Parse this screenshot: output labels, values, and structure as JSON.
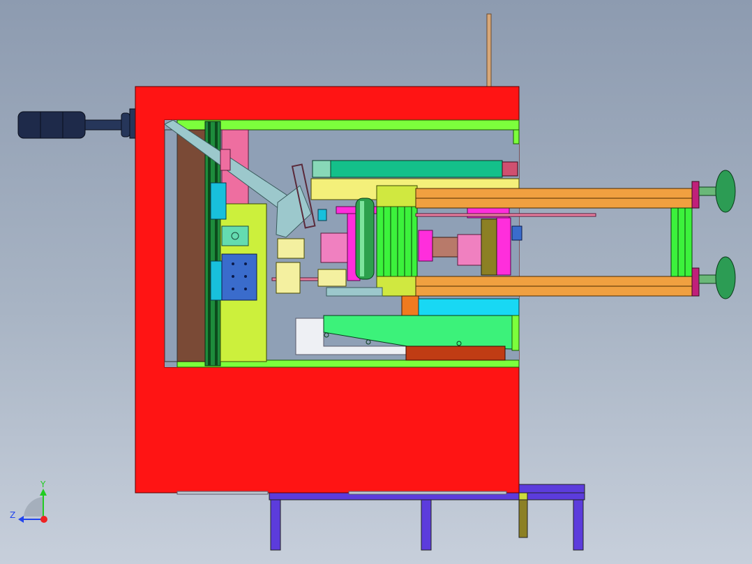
{
  "viewport": {
    "background_top": "#8d9bb0",
    "background_bottom": "#c7cfdb"
  },
  "colors": {
    "frame_red": "#ff1414",
    "frame_green": "#7cff3c",
    "yellow_green": "#ccf03c",
    "brown": "#7a4a36",
    "pink": "#ee6ea0",
    "magenta": "#ff2edc",
    "orange": "#f0a040",
    "teal": "#14c08a",
    "cyan": "#18d8f4",
    "blue": "#3a6ccc",
    "navy": "#1e2a4a",
    "purple": "#5c3cdc",
    "olive": "#8c8024",
    "rust": "#c03c14",
    "green_bar": "#3cf23c",
    "knob_green": "#2c9c54"
  },
  "triad": {
    "y_label": "Y",
    "z_label": "Z",
    "y_color": "#22cc22",
    "z_color": "#2244ee",
    "x_color": "#ee2222"
  }
}
